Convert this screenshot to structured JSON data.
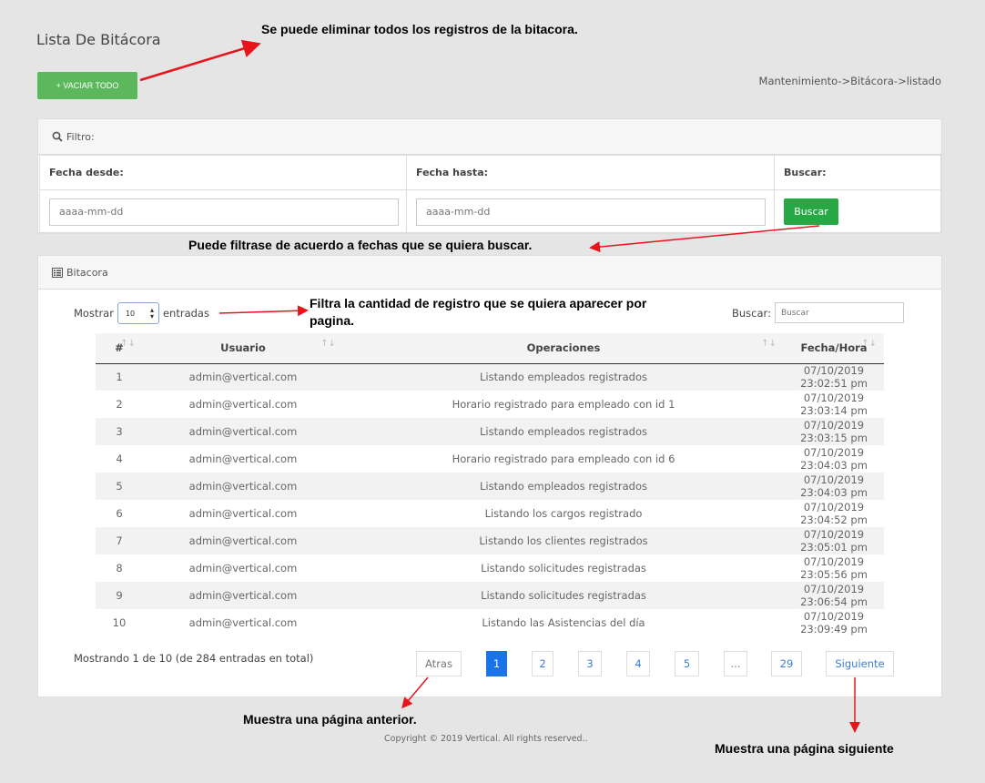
{
  "page": {
    "title": "Lista De Bitácora",
    "vaciar_button": "+ VACIAR TODO",
    "breadcrumb": "Mantenimiento->Bitácora->listado"
  },
  "filter": {
    "heading": "Filtro:",
    "col_from": "Fecha desde:",
    "col_to": "Fecha hasta:",
    "col_search": "Buscar:",
    "from_placeholder": "aaaa-mm-dd",
    "to_placeholder": "aaaa-mm-dd",
    "search_button": "Buscar"
  },
  "bitacora": {
    "heading": "Bitacora",
    "show_label": "Mostrar",
    "show_value": "10",
    "entries_label": "entradas",
    "search_label": "Buscar:",
    "search_placeholder": "Buscar",
    "columns": [
      "#",
      "Usuario",
      "Operaciones",
      "Fecha/Hora"
    ],
    "rows": [
      [
        "1",
        "admin@vertical.com",
        "Listando empleados registrados",
        "07/10/2019 23:02:51 pm"
      ],
      [
        "2",
        "admin@vertical.com",
        "Horario registrado para empleado con id 1",
        "07/10/2019 23:03:14 pm"
      ],
      [
        "3",
        "admin@vertical.com",
        "Listando empleados registrados",
        "07/10/2019 23:03:15 pm"
      ],
      [
        "4",
        "admin@vertical.com",
        "Horario registrado para empleado con id 6",
        "07/10/2019 23:04:03 pm"
      ],
      [
        "5",
        "admin@vertical.com",
        "Listando empleados registrados",
        "07/10/2019 23:04:03 pm"
      ],
      [
        "6",
        "admin@vertical.com",
        "Listando los cargos registrado",
        "07/10/2019 23:04:52 pm"
      ],
      [
        "7",
        "admin@vertical.com",
        "Listando los clientes registrados",
        "07/10/2019 23:05:01 pm"
      ],
      [
        "8",
        "admin@vertical.com",
        "Listando solicitudes registradas",
        "07/10/2019 23:05:56 pm"
      ],
      [
        "9",
        "admin@vertical.com",
        "Listando solicitudes registradas",
        "07/10/2019 23:06:54 pm"
      ],
      [
        "10",
        "admin@vertical.com",
        "Listando las Asistencias del día",
        "07/10/2019 23:09:49 pm"
      ]
    ],
    "info": "Mostrando 1 de 10 (de 284 entradas en total)",
    "pagination": {
      "prev": "Atras",
      "pages": [
        "1",
        "2",
        "3",
        "4",
        "5",
        "...",
        "29"
      ],
      "next": "Siguiente"
    }
  },
  "footer": "Copyright © 2019 Vertical. All rights reserved..",
  "annotations": {
    "vaciar": "Se puede eliminar todos los registros de la bitacora.",
    "filter": "Puede filtrase de acuerdo a fechas que se quiera buscar.",
    "length_line1": "Filtra la cantidad de registro que se quiera aparecer por",
    "length_line2": "pagina.",
    "prev": "Muestra una página anterior.",
    "next": "Muestra una página siguiente"
  },
  "colors": {
    "annotation_arrow": "#e8141c",
    "success": "#28a745",
    "vaciar": "#5cb85c",
    "pager_active": "#1a73e8"
  }
}
